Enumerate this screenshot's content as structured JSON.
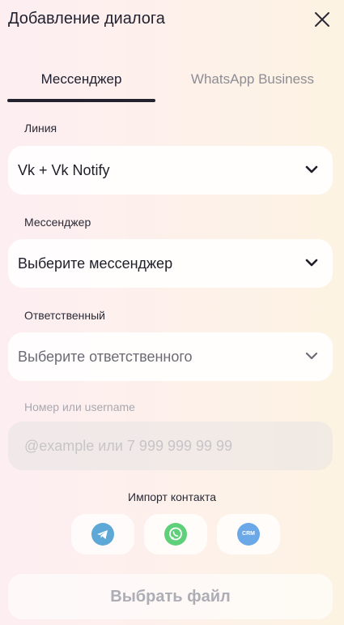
{
  "header": {
    "title": "Добавление диалога"
  },
  "tabs": [
    {
      "label": "Мессенджер",
      "active": true
    },
    {
      "label": "WhatsApp Business",
      "active": false
    }
  ],
  "form": {
    "line": {
      "label": "Линия",
      "value": "Vk + Vk Notify"
    },
    "messenger": {
      "label": "Мессенджер",
      "value": "Выберите мессенджер"
    },
    "responsible": {
      "label": "Ответственный",
      "value": "Выберите ответственного"
    },
    "contact": {
      "label": "Номер или username",
      "placeholder": "@example или 7 999 999 99 99"
    }
  },
  "import": {
    "title": "Импорт контакта",
    "buttons": [
      {
        "icon": "telegram-icon"
      },
      {
        "icon": "whatsapp-icon"
      },
      {
        "icon": "crm-icon",
        "text": "CRM"
      }
    ]
  },
  "submit_label": "Выбрать файл",
  "colors": {
    "telegram": "#5da8d6",
    "whatsapp": "#5fd07a",
    "crm": "#6aa8e8",
    "active_tab_underline": "#23232f"
  }
}
